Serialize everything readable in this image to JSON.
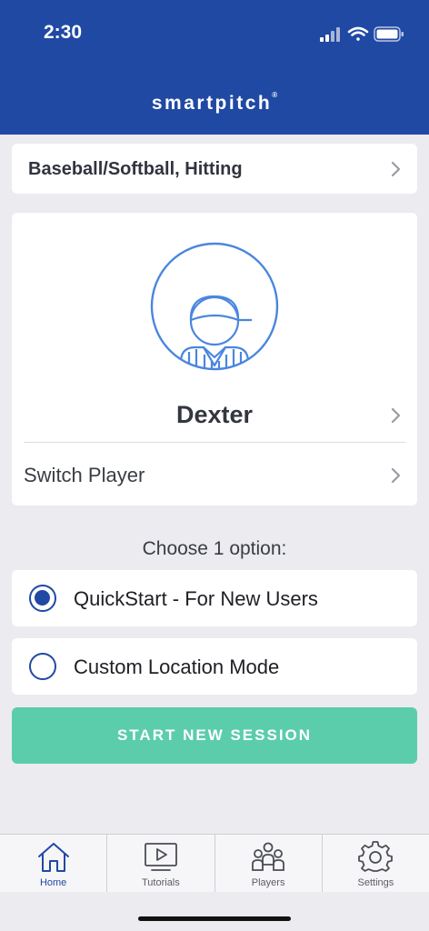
{
  "status_bar": {
    "time": "2:30"
  },
  "header": {
    "brand": "smartpitch",
    "brand_mark": "®"
  },
  "sport_selector": {
    "label": "Baseball/Softball, Hitting"
  },
  "player": {
    "name": "Dexter",
    "switch_label": "Switch Player"
  },
  "options": {
    "heading": "Choose 1 option:",
    "items": [
      {
        "label": "QuickStart - For New Users",
        "selected": true
      },
      {
        "label": "Custom Location Mode",
        "selected": false
      }
    ]
  },
  "start_button": {
    "label": "START NEW SESSION"
  },
  "colors": {
    "primary": "#2049a3",
    "accent": "#5bcdab",
    "background": "#ebebf0"
  },
  "tabbar": {
    "tabs": [
      {
        "label": "Home",
        "icon": "home-icon",
        "active": true
      },
      {
        "label": "Tutorials",
        "icon": "play-screen-icon",
        "active": false
      },
      {
        "label": "Players",
        "icon": "group-icon",
        "active": false
      },
      {
        "label": "Settings",
        "icon": "gear-icon",
        "active": false
      }
    ]
  }
}
